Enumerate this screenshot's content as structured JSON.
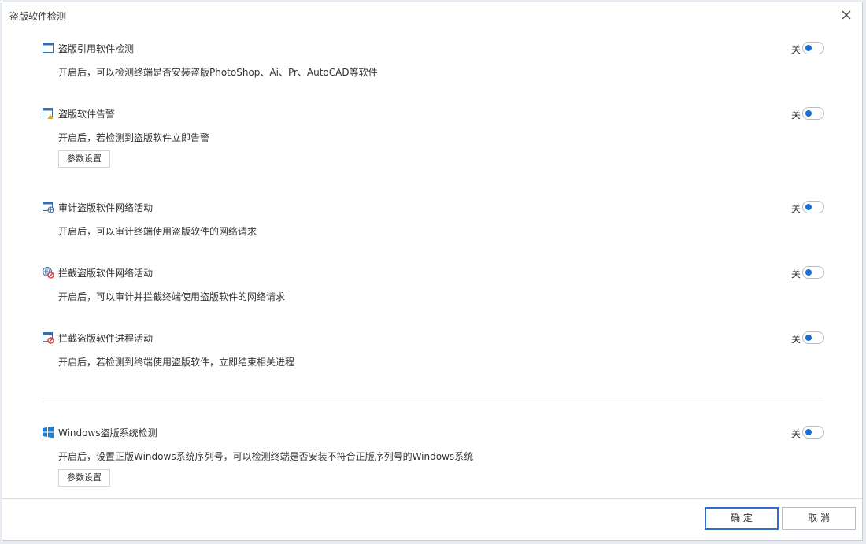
{
  "dialog": {
    "title": "盗版软件检测",
    "close_icon": "close-icon"
  },
  "sections": [
    {
      "icon": "window-icon",
      "title": "盗版引用软件检测",
      "toggle_label": "关",
      "description": "开启后，可以检测终端是否安装盗版PhotoShop、Ai、Pr、AutoCAD等软件"
    },
    {
      "icon": "window-alert-icon",
      "title": "盗版软件告警",
      "toggle_label": "关",
      "description": "开启后，若检测到盗版软件立即告警",
      "param_button": "参数设置"
    },
    {
      "icon": "window-globe-icon",
      "title": "审计盗版软件网络活动",
      "toggle_label": "关",
      "description": "开启后，可以审计终端使用盗版软件的网络请求"
    },
    {
      "icon": "globe-block-icon",
      "title": "拦截盗版软件网络活动",
      "toggle_label": "关",
      "description": "开启后，可以审计并拦截终端使用盗版软件的网络请求"
    },
    {
      "icon": "window-block-icon",
      "title": "拦截盗版软件进程活动",
      "toggle_label": "关",
      "description": "开启后，若检测到终端使用盗版软件，立即结束相关进程"
    },
    {
      "icon": "windows-logo-icon",
      "title": "Windows盗版系统检测",
      "toggle_label": "关",
      "description": "开启后，设置正版Windows系统序列号，可以检测终端是否安装不符合正版序列号的Windows系统",
      "param_button": "参数设置"
    }
  ],
  "footer": {
    "ok_label": "确 定",
    "cancel_label": "取 消"
  },
  "colors": {
    "accent": "#1a6fd6",
    "ok_border": "#2f6fc7",
    "alert": "#f0a020",
    "block": "#e03a3a"
  }
}
